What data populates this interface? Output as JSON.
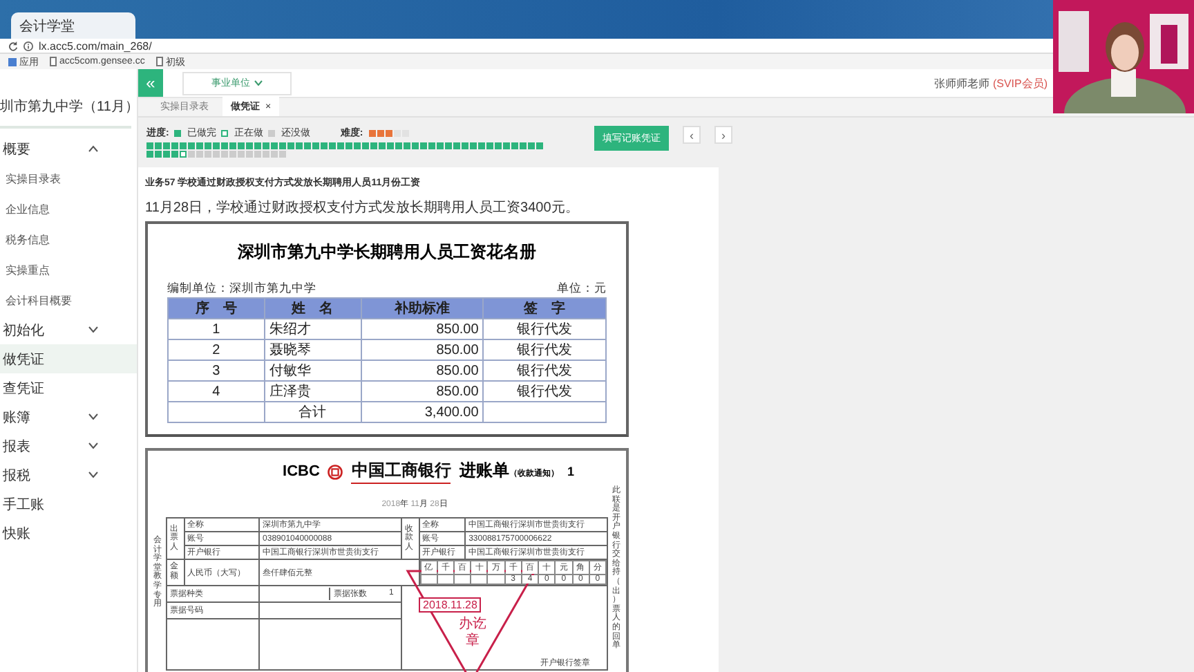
{
  "browser": {
    "tab_title": "会计学堂",
    "address": "lx.acc5.com/main_268/",
    "bookmarks": [
      {
        "label": "应用",
        "kind": "apps"
      },
      {
        "label": "acc5com.gensee.cc",
        "kind": "page"
      },
      {
        "label": "初级",
        "kind": "page"
      }
    ]
  },
  "sidebar": {
    "header": "圳市第九中学（11月）",
    "items": [
      {
        "label": "概要",
        "kind": "group",
        "expanded": true,
        "selected": false,
        "children": [
          {
            "label": "实操目录表"
          },
          {
            "label": "企业信息"
          },
          {
            "label": "税务信息"
          },
          {
            "label": "实操重点"
          },
          {
            "label": "会计科目概要"
          }
        ]
      },
      {
        "label": "初始化",
        "kind": "group",
        "expanded": false,
        "selected": false
      },
      {
        "label": "做凭证",
        "kind": "link",
        "selected": true
      },
      {
        "label": "查凭证",
        "kind": "link",
        "selected": false
      },
      {
        "label": "账簿",
        "kind": "group",
        "expanded": false,
        "selected": false
      },
      {
        "label": "报表",
        "kind": "group",
        "expanded": false,
        "selected": false
      },
      {
        "label": "报税",
        "kind": "group",
        "expanded": false,
        "selected": false
      },
      {
        "label": "手工账",
        "kind": "link",
        "selected": false
      },
      {
        "label": "快账",
        "kind": "link",
        "selected": false
      }
    ]
  },
  "topbar": {
    "collapse": "«",
    "unit_type": "事业单位",
    "user": "张师师老师",
    "membership": "(SVIP会员)"
  },
  "tabs": [
    {
      "label": "实操目录表",
      "selected": false
    },
    {
      "label": "做凭证",
      "selected": true,
      "close": "×"
    }
  ],
  "progress": {
    "label": "进度:",
    "legend": [
      {
        "label": "已做完",
        "kind": "done"
      },
      {
        "label": "正在做",
        "kind": "doing"
      },
      {
        "label": "还没做",
        "kind": "todo"
      }
    ],
    "difficulty_label": "难度:",
    "stars": 3,
    "cells": [
      {
        "kind": "done"
      },
      {
        "kind": "done"
      },
      {
        "kind": "done"
      },
      {
        "kind": "done"
      },
      {
        "kind": "done"
      },
      {
        "kind": "done"
      },
      {
        "kind": "done"
      },
      {
        "kind": "done"
      },
      {
        "kind": "done"
      },
      {
        "kind": "done"
      },
      {
        "kind": "done"
      },
      {
        "kind": "done"
      },
      {
        "kind": "done"
      },
      {
        "kind": "done"
      },
      {
        "kind": "done"
      },
      {
        "kind": "done"
      },
      {
        "kind": "done"
      },
      {
        "kind": "done"
      },
      {
        "kind": "done"
      },
      {
        "kind": "done"
      },
      {
        "kind": "done"
      },
      {
        "kind": "done"
      },
      {
        "kind": "done"
      },
      {
        "kind": "done"
      },
      {
        "kind": "done"
      },
      {
        "kind": "done"
      },
      {
        "kind": "done"
      },
      {
        "kind": "done"
      },
      {
        "kind": "done"
      },
      {
        "kind": "done"
      },
      {
        "kind": "done"
      },
      {
        "kind": "done"
      },
      {
        "kind": "done"
      },
      {
        "kind": "done"
      },
      {
        "kind": "done"
      },
      {
        "kind": "done"
      },
      {
        "kind": "done"
      },
      {
        "kind": "done"
      },
      {
        "kind": "done"
      },
      {
        "kind": "done"
      },
      {
        "kind": "done"
      },
      {
        "kind": "done"
      },
      {
        "kind": "done"
      },
      {
        "kind": "done"
      },
      {
        "kind": "done"
      },
      {
        "kind": "done"
      },
      {
        "kind": "done"
      },
      {
        "kind": "done"
      },
      {
        "kind": "done"
      },
      {
        "kind": "done"
      },
      {
        "kind": "done"
      },
      {
        "kind": "done"
      },
      {
        "kind": "doing"
      },
      {
        "kind": "todo"
      },
      {
        "kind": "todo"
      },
      {
        "kind": "todo"
      },
      {
        "kind": "todo"
      },
      {
        "kind": "todo"
      },
      {
        "kind": "todo"
      },
      {
        "kind": "todo"
      },
      {
        "kind": "todo"
      },
      {
        "kind": "todo"
      },
      {
        "kind": "todo"
      },
      {
        "kind": "todo"
      },
      {
        "kind": "todo"
      }
    ]
  },
  "actions": {
    "fill_voucher": "填写记账凭证",
    "prev": "‹",
    "next": "›"
  },
  "task": {
    "title": "业务57 学校通过财政授权支付方式发放长期聘用人员11月份工资",
    "description": "11月28日，学校通过财政授权支付方式发放长期聘用人员工资3400元。"
  },
  "roster": {
    "title": "深圳市第九中学长期聘用人员工资花名册",
    "unit_label": "编制单位：深圳市第九中学",
    "currency": "单位：元",
    "columns": [
      "序　号",
      "姓　名",
      "补助标准",
      "签　字"
    ],
    "rows": [
      [
        "1",
        "朱绍才",
        "850.00",
        "银行代发"
      ],
      [
        "2",
        "聂晓琴",
        "850.00",
        "银行代发"
      ],
      [
        "3",
        "付敏华",
        "850.00",
        "银行代发"
      ],
      [
        "4",
        "庄泽贵",
        "850.00",
        "银行代发"
      ]
    ],
    "total": {
      "label": "合计",
      "amount": "3,400.00"
    }
  },
  "slip": {
    "bank_mark": "ICBC",
    "bank_name": "中国工商银行",
    "title": "进账单",
    "subtitle": "（收款通知）",
    "copy_no": "1",
    "side_note": "此联是开户银行交给持（出）票人的回单",
    "left_note": "会计学堂教学专用",
    "date": {
      "year": "2018",
      "year_unit": "年",
      "month": "11",
      "month_unit": "月",
      "day": "28",
      "day_unit": "日"
    },
    "payer": {
      "label": "出票人",
      "fields": [
        {
          "label": "全称",
          "value": "深圳市第九中学"
        },
        {
          "label": "账号",
          "value": "038901040000088"
        },
        {
          "label": "开户银行",
          "value": "中国工商银行深圳市世贵街支行"
        }
      ]
    },
    "payee": {
      "label": "收款人",
      "fields": [
        {
          "label": "全称",
          "value": "中国工商银行深圳市世贵街支行"
        },
        {
          "label": "账号",
          "value": "330088175700006622"
        },
        {
          "label": "开户银行",
          "value": "中国工商银行深圳市世贵街支行"
        }
      ]
    },
    "amount": {
      "label": "金额",
      "currency_label": "人民币（大写）",
      "words": "叁仟肆佰元整",
      "digits": [
        {
          "unit": "亿"
        },
        {
          "unit": "千"
        },
        {
          "unit": "百"
        },
        {
          "unit": "十"
        },
        {
          "unit": "万"
        },
        {
          "unit": "千",
          "digit": "3"
        },
        {
          "unit": "百",
          "digit": "4"
        },
        {
          "unit": "十",
          "digit": "0"
        },
        {
          "unit": "元",
          "digit": "0"
        },
        {
          "unit": "角",
          "digit": "0"
        },
        {
          "unit": "分",
          "digit": "0"
        }
      ]
    },
    "bill_type_label": "票据种类",
    "bill_count_label": "票据张数",
    "bill_count": "1",
    "bill_no_label": "票据号码",
    "seal_label": "开户银行签章",
    "stamp": {
      "date": "2018.11.28",
      "text": "办讫章"
    }
  }
}
